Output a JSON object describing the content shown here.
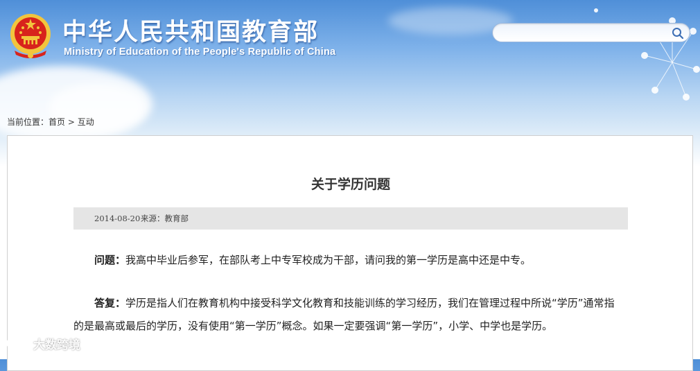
{
  "header": {
    "title_cn": "中华人民共和国教育部",
    "title_en": "Ministry of Education of the People's Republic of China",
    "search_placeholder": "",
    "emblem_icon": "national-emblem-icon",
    "search_icon": "search-icon"
  },
  "breadcrumb": {
    "prefix": "当前位置：",
    "home": "首页",
    "separator": " > ",
    "current": "互动"
  },
  "article": {
    "title": "关于学历问题",
    "date": "2014-08-20",
    "source": "来源：教育部",
    "question_label": "问题：",
    "question_text": "我高中毕业后参军，在部队考上中专军校成为干部，请问我的第一学历是高中还是中专。",
    "answer_label": "答复：",
    "answer_text": "学历是指人们在教育机构中接受科学文化教育和技能训练的学习经历，我们在管理过程中所说“学历”通常指的是最高或最后的学历，没有使用“第一学历”概念。如果一定要强调“第一学历”，小学、中学也是学历。"
  },
  "watermark": {
    "text": "大数跨境",
    "icon": "chat-bubbles-icon"
  },
  "colors": {
    "sky_top": "#4f8fd8",
    "emblem_red": "#d8231c",
    "emblem_gold": "#f2c53d",
    "meta_bar": "#e5e5e5"
  }
}
